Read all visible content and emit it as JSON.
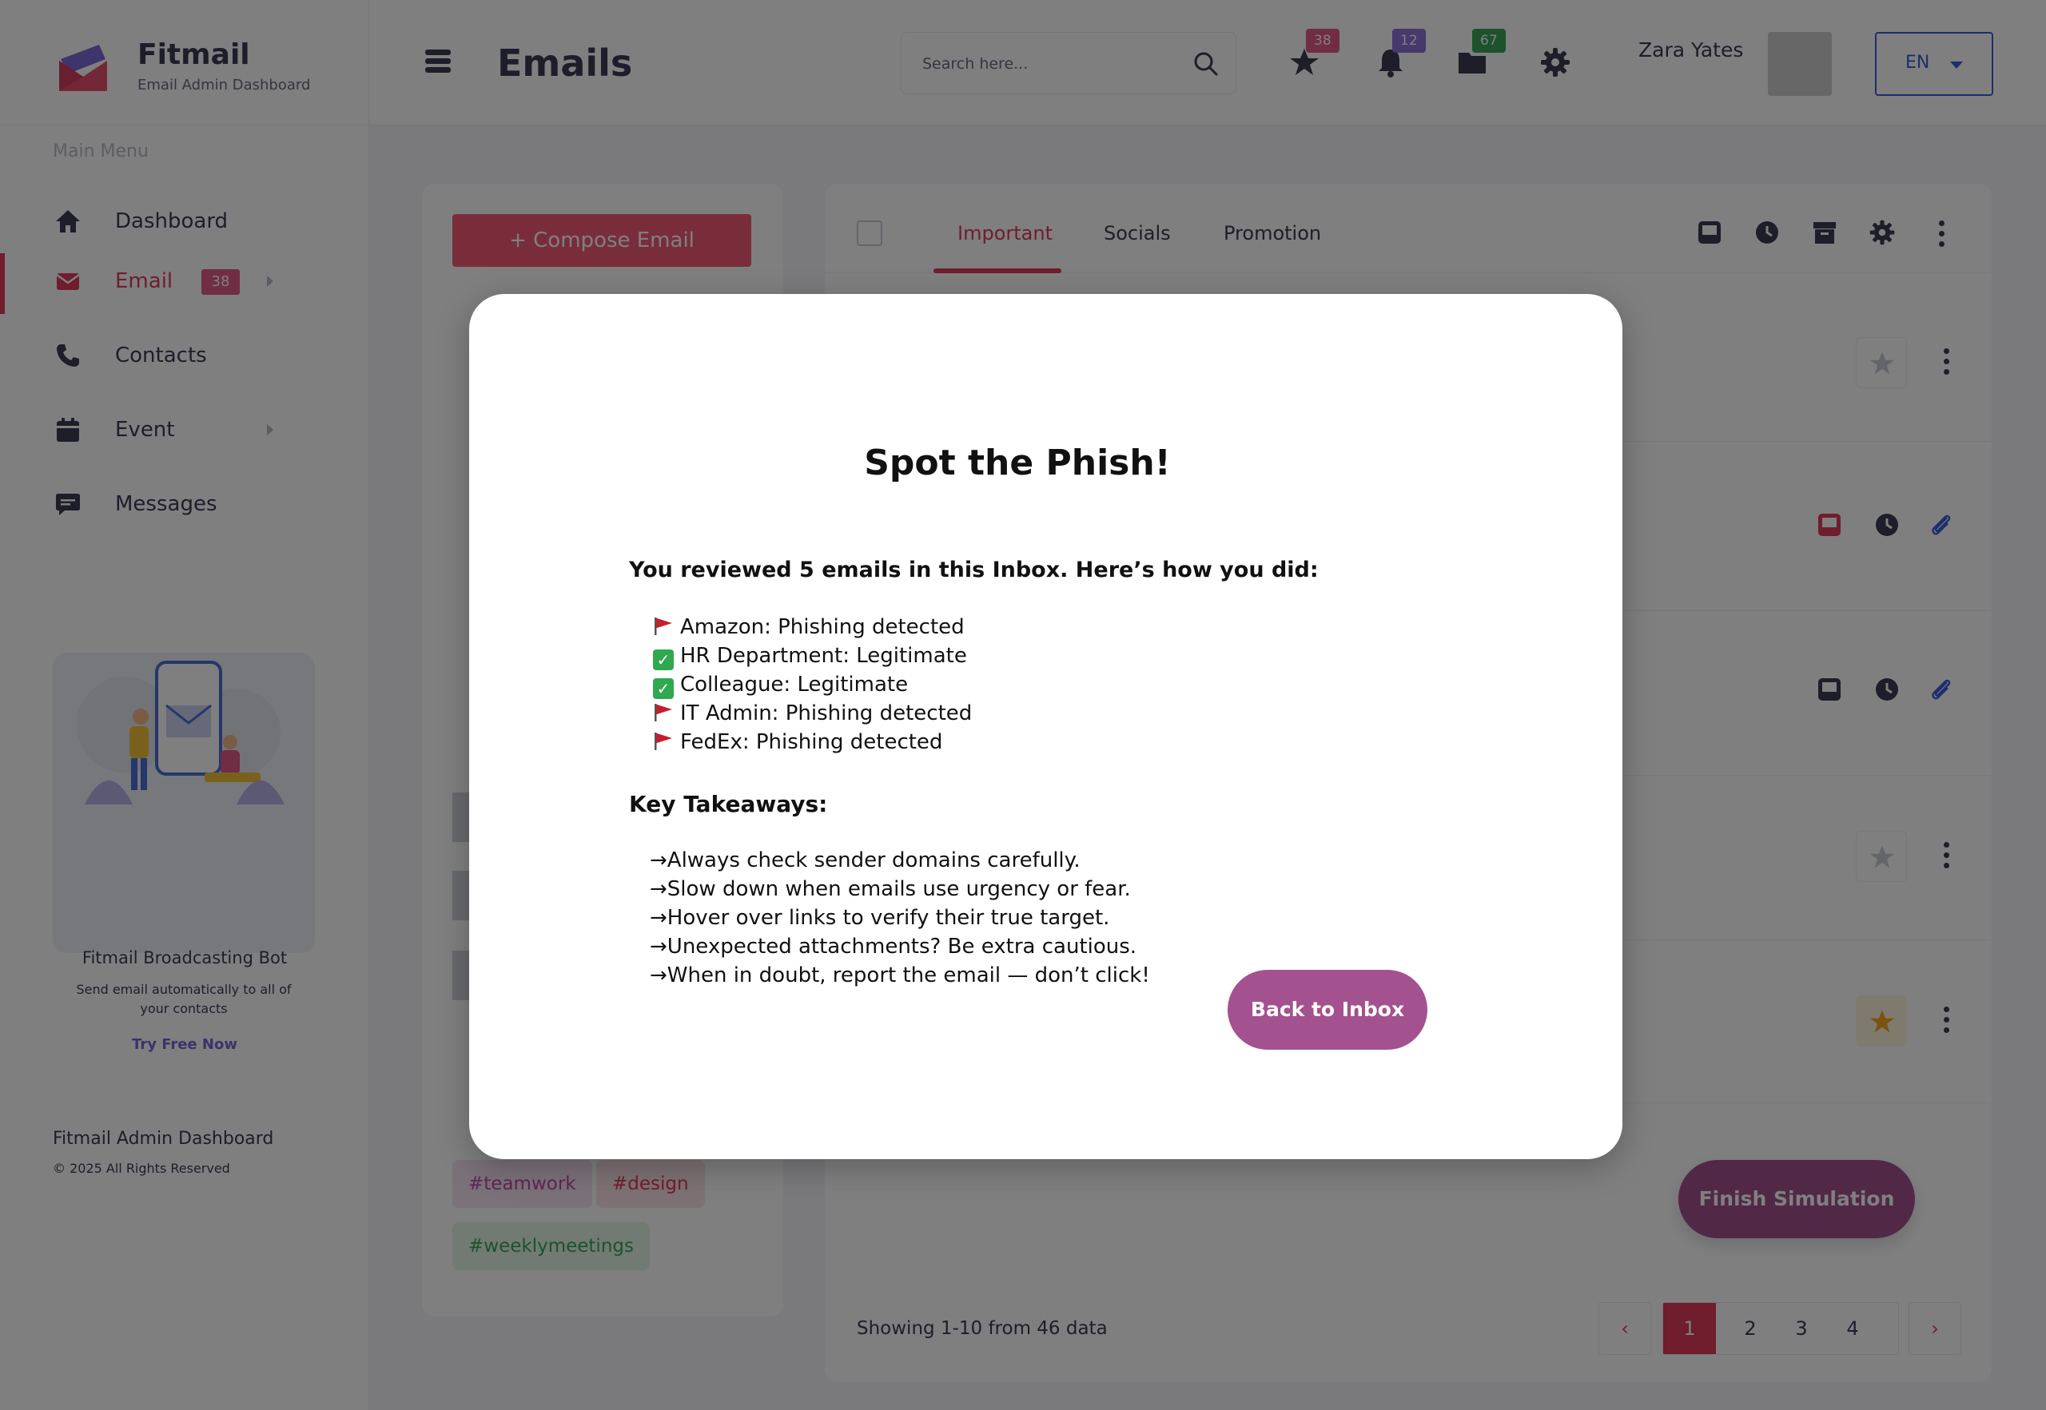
{
  "app": {
    "name": "Fitmail",
    "subtitle": "Email Admin Dashboard"
  },
  "header": {
    "title": "Emails",
    "search_placeholder": "Search here...",
    "badges": {
      "favorites": "38",
      "notifications": "12",
      "folders": "67"
    },
    "user_name": "Zara Yates",
    "language": "EN",
    "colors": {
      "favorites_badge": "#e05a86",
      "notifications_badge": "#8c73d9",
      "folders_badge": "#3aa55a"
    }
  },
  "sidebar": {
    "menu_label": "Main Menu",
    "items": [
      {
        "label": "Dashboard",
        "icon": "home-icon"
      },
      {
        "label": "Email",
        "icon": "mail-icon",
        "badge": "38"
      },
      {
        "label": "Contacts",
        "icon": "phone-icon"
      },
      {
        "label": "Event",
        "icon": "calendar-icon"
      },
      {
        "label": "Messages",
        "icon": "chat-icon"
      }
    ],
    "promo": {
      "title": "Fitmail Broadcasting Bot",
      "subtitle": "Send email automatically to all of your contacts",
      "cta": "Try Free Now"
    },
    "footer": {
      "title": "Fitmail Admin Dashboard",
      "copyright": "© 2025 All Rights Reserved"
    }
  },
  "left_panel": {
    "compose_label": "+ Compose Email",
    "tags": [
      "#teamwork",
      "#design",
      "#weeklymeetings"
    ]
  },
  "main": {
    "tabs": [
      "Important",
      "Socials",
      "Promotion"
    ],
    "active_tab": "Important",
    "finish_label": "Finish Simulation",
    "showing": "Showing 1-10 from 46 data",
    "pagination": {
      "prev": "‹",
      "next": "›",
      "pages": [
        "1",
        "2",
        "3",
        "4"
      ],
      "current": "1"
    }
  },
  "modal": {
    "title": "Spot the Phish!",
    "intro": "You reviewed 5 emails in this Inbox.  Here’s how you did:",
    "results": [
      {
        "icon": "red-flag-icon",
        "text": "Amazon: Phishing detected"
      },
      {
        "icon": "check-mark-icon",
        "text": "HR Department: Legitimate"
      },
      {
        "icon": "check-mark-icon",
        "text": "Colleague: Legitimate"
      },
      {
        "icon": "red-flag-icon",
        "text": "IT Admin: Phishing detected"
      },
      {
        "icon": "red-flag-icon",
        "text": "FedEx: Phishing detected"
      }
    ],
    "takeaways_heading": "Key Takeaways:",
    "takeaways": [
      "→Always check sender domains carefully.",
      "→Slow down when emails use urgency or fear.",
      "→Hover over links to verify their true target.",
      "→Unexpected attachments? Be extra cautious.",
      "→When in doubt, report the email — don’t click!"
    ],
    "back_label": "Back to Inbox"
  },
  "colors": {
    "accent": "#e03a5a",
    "primary_button": "#a4518f",
    "compose_button": "#f25a76"
  }
}
